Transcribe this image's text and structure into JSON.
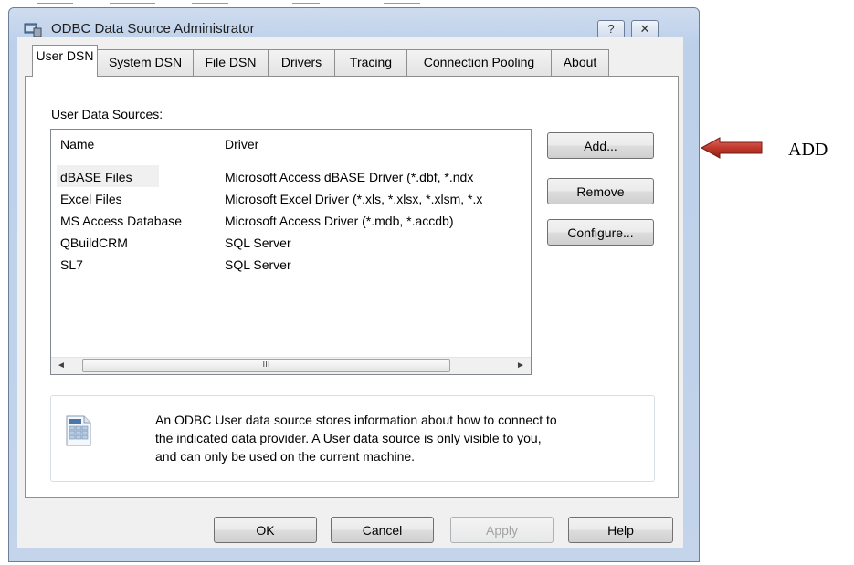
{
  "window": {
    "title": "ODBC Data Source Administrator",
    "help_glyph": "?",
    "close_glyph": "✕"
  },
  "tabs": [
    {
      "label": "User DSN",
      "active": true
    },
    {
      "label": "System DSN",
      "active": false
    },
    {
      "label": "File DSN",
      "active": false
    },
    {
      "label": "Drivers",
      "active": false
    },
    {
      "label": "Tracing",
      "active": false
    },
    {
      "label": "Connection Pooling",
      "active": false
    },
    {
      "label": "About",
      "active": false
    }
  ],
  "sources": {
    "label": "User Data Sources:",
    "columns": {
      "name": "Name",
      "driver": "Driver"
    },
    "rows": [
      {
        "name": "dBASE Files",
        "driver": "Microsoft Access dBASE Driver (*.dbf, *.ndx"
      },
      {
        "name": "Excel Files",
        "driver": "Microsoft Excel Driver (*.xls, *.xlsx, *.xlsm, *.x"
      },
      {
        "name": "MS Access Database",
        "driver": "Microsoft Access Driver (*.mdb, *.accdb)"
      },
      {
        "name": "QBuildCRM",
        "driver": "SQL Server"
      },
      {
        "name": "SL7",
        "driver": "SQL Server"
      }
    ],
    "scroll": {
      "left": "◄",
      "right": "►",
      "grip": "III"
    }
  },
  "side_buttons": {
    "add": "Add...",
    "remove": "Remove",
    "configure": "Configure..."
  },
  "info": {
    "line1": "An ODBC User data source stores information about how to connect to",
    "line2": "the indicated data provider.  A User data source is only visible to you,",
    "line3": "and can only be used on the current machine."
  },
  "footer": {
    "ok": "OK",
    "cancel": "Cancel",
    "apply": "Apply",
    "help": "Help"
  },
  "annotation": {
    "label": "ADD",
    "arrow_color": "#c0392b"
  }
}
